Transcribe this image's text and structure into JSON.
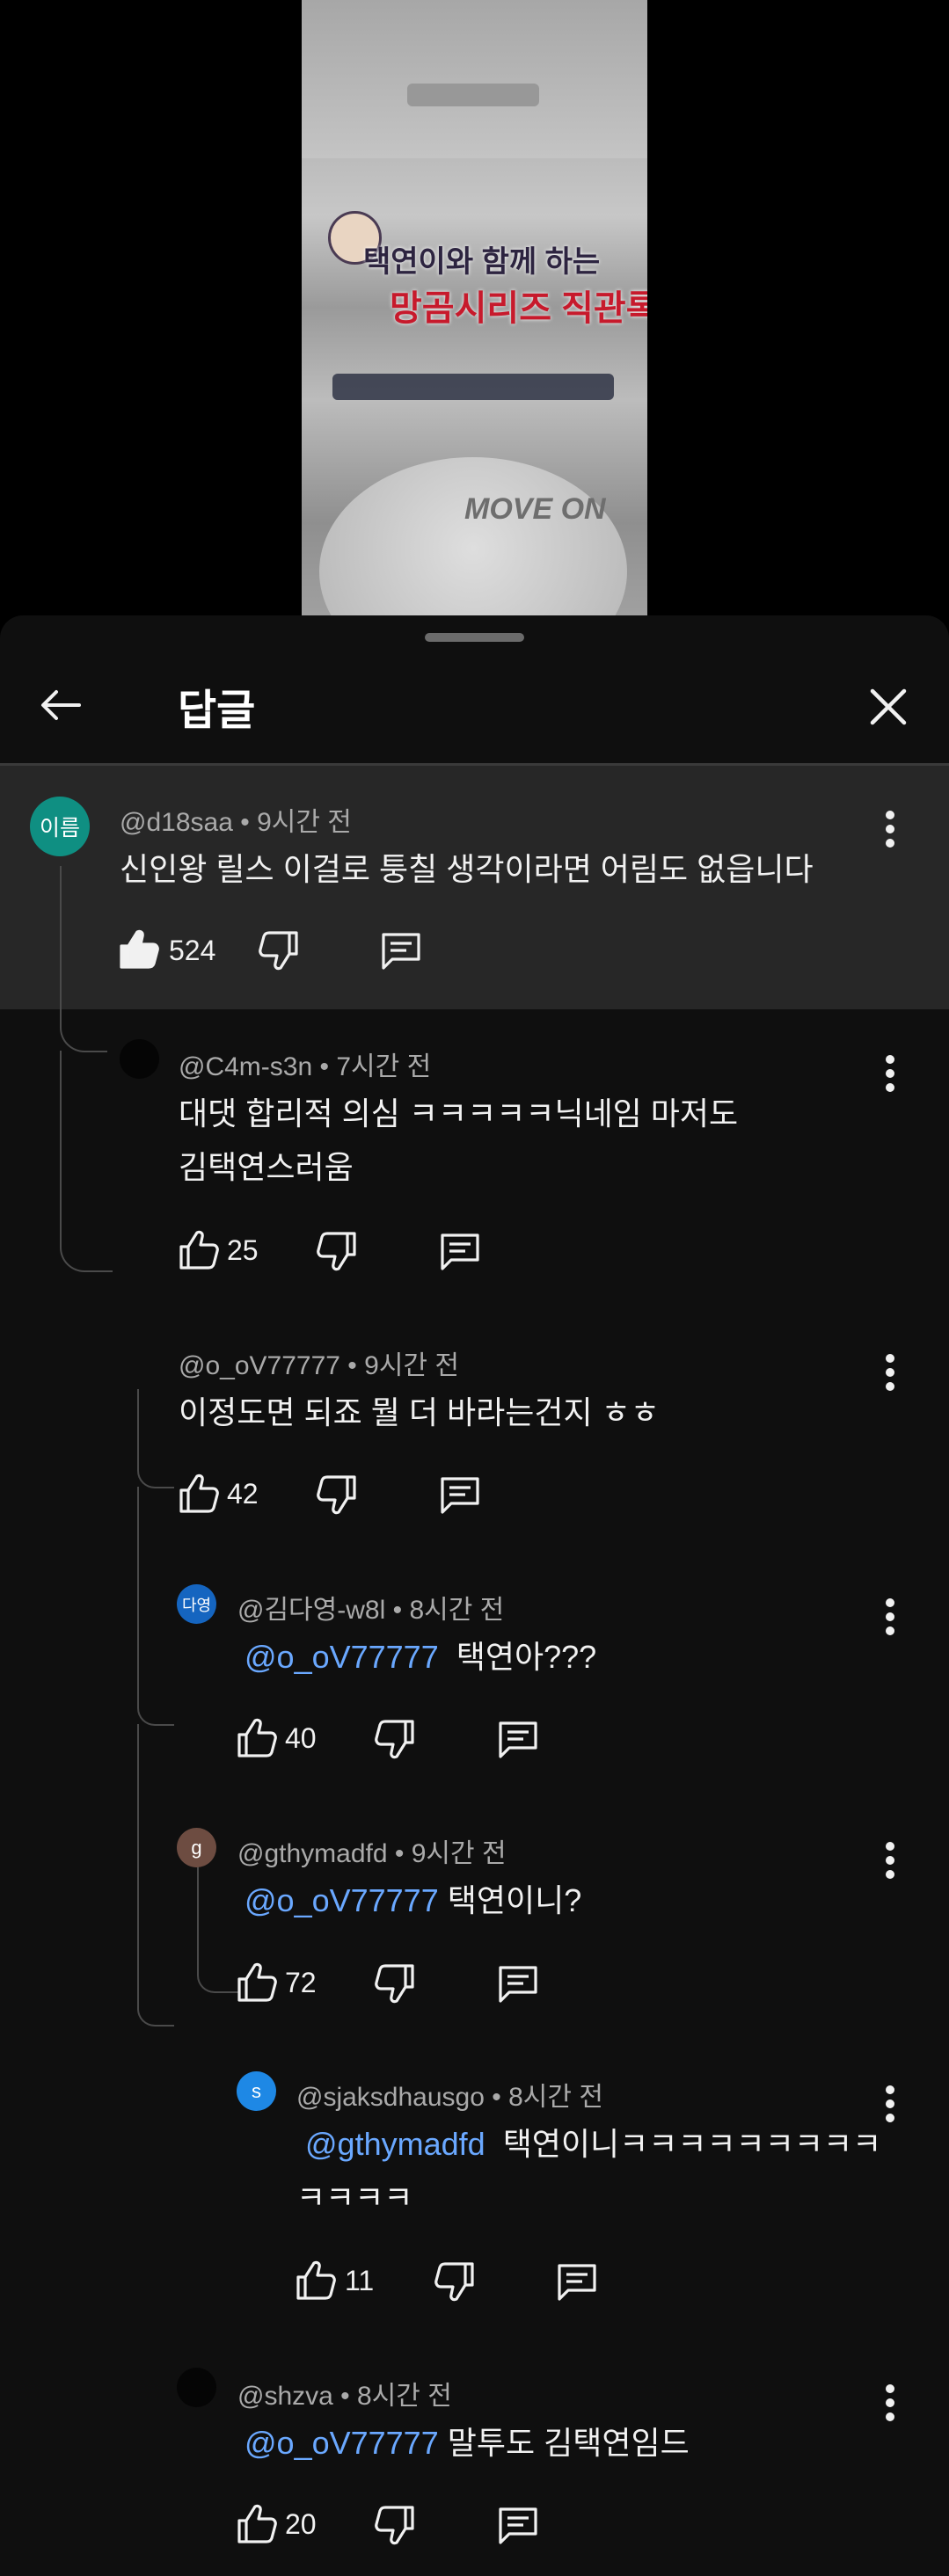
{
  "header": {
    "title": "답글"
  },
  "video_thumbnail": {
    "title_line1": "택연이와 함께 하는",
    "title_line2": "망곰시리즈 직관록",
    "badge": "MOVE ON"
  },
  "comments": [
    {
      "avatar_text": "이름",
      "author": "@d18saa",
      "time": "9시간 전",
      "lines": [
        "신인왕 릴스 이걸로 퉁칠 생각이라면 어림도 없읍니다"
      ],
      "likes": "524"
    },
    {
      "avatar_text": "",
      "author": "@C4m-s3n",
      "time": "7시간 전",
      "lines": [
        "대댓 합리적 의심 ㅋㅋㅋㅋㅋ닉네임 마저도",
        "김택연스러움"
      ],
      "likes": "25"
    },
    {
      "avatar_text": "",
      "author": "@o_oV77777",
      "time": "9시간 전",
      "lines": [
        "이정도면 되죠 뭘 더 바라는건지 ㅎㅎ"
      ],
      "likes": "42"
    },
    {
      "avatar_text": "다영",
      "author": "@김다영-w8l",
      "time": "8시간 전",
      "mention": "@o_oV77777",
      "lines": [
        "택연아???"
      ],
      "likes": "40"
    },
    {
      "avatar_text": "g",
      "author": "@gthymadfd",
      "time": "9시간 전",
      "mention": "@o_oV77777",
      "lines": [
        "택연이니?"
      ],
      "likes": "72"
    },
    {
      "avatar_text": "s",
      "author": "@sjaksdhausgo",
      "time": "8시간 전",
      "mention": "@gthymadfd",
      "lines": [
        "택연이니ㅋㅋㅋㅋㅋㅋㅋㅋㅋ",
        "ㅋㅋㅋㅋ"
      ],
      "likes": "11"
    },
    {
      "avatar_text": "",
      "author": "@shzva",
      "time": "8시간 전",
      "mention": "@o_oV77777",
      "lines": [
        "말투도 김택연임드"
      ],
      "likes": "20"
    }
  ],
  "colors": {
    "background": "#0f0f0f",
    "highlight": "#272727",
    "mention": "#6aa8ff",
    "avatar_teal": "#0f8f82",
    "avatar_blue": "#1565c0",
    "avatar_brown": "#6d4c41",
    "avatar_sky": "#1e88e5"
  },
  "icons": [
    "back-arrow-icon",
    "close-icon",
    "more-vert-icon",
    "thumb-up-icon",
    "thumb-down-icon",
    "reply-icon"
  ]
}
